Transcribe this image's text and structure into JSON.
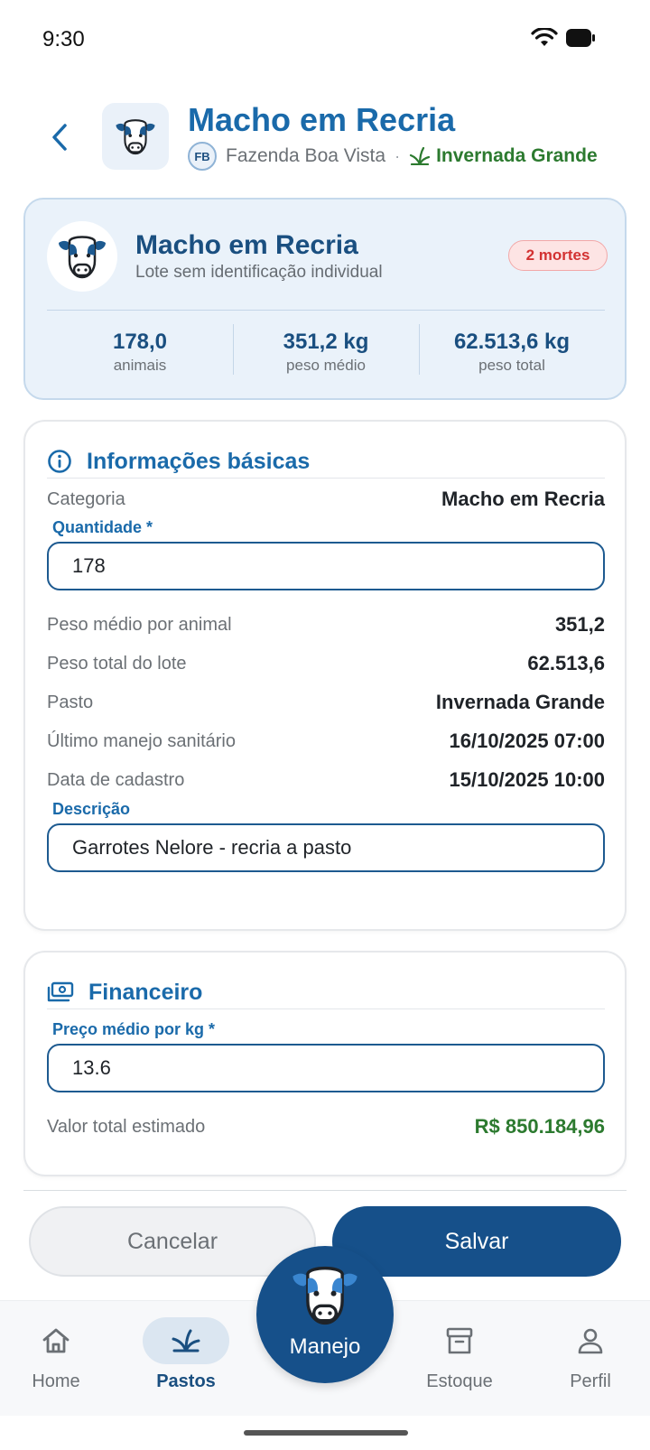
{
  "status": {
    "time": "9:30"
  },
  "header": {
    "title": "Macho em Recria",
    "farm_initials": "FB",
    "farm_name": "Fazenda Boa Vista",
    "separator": "·",
    "pasture_name": "Invernada Grande"
  },
  "summary": {
    "title": "Macho em Recria",
    "subtitle": "Lote sem identificação individual",
    "deaths_badge": "2 mortes",
    "stats": [
      {
        "value": "178,0",
        "label": "animais"
      },
      {
        "value": "351,2 kg",
        "label": "peso médio"
      },
      {
        "value": "62.513,6 kg",
        "label": "peso total"
      }
    ]
  },
  "basic": {
    "title": "Informações básicas",
    "category_label": "Categoria",
    "category_value": "Macho em Recria",
    "quantity_label": "Quantidade *",
    "quantity_value": "178",
    "rows": [
      {
        "label": "Peso médio por animal",
        "value": "351,2"
      },
      {
        "label": "Peso total do lote",
        "value": "62.513,6"
      },
      {
        "label": "Pasto",
        "value": "Invernada Grande"
      },
      {
        "label": "Último manejo sanitário",
        "value": "16/10/2025 07:00"
      },
      {
        "label": "Data de cadastro",
        "value": "15/10/2025 10:00"
      }
    ],
    "description_label": "Descrição",
    "description_value": "Garrotes Nelore - recria a pasto"
  },
  "financial": {
    "title": "Financeiro",
    "price_label": "Preço médio por kg *",
    "price_value": "13.6",
    "total_label": "Valor total estimado",
    "total_value": "R$ 850.184,96"
  },
  "actions": {
    "cancel": "Cancelar",
    "save": "Salvar"
  },
  "nav": {
    "home": "Home",
    "pastos": "Pastos",
    "manejo": "Manejo",
    "estoque": "Estoque",
    "perfil": "Perfil"
  },
  "colors": {
    "primary": "#1a6aaa",
    "primary_dark": "#16508a",
    "success": "#2c7a2f",
    "danger": "#d33232"
  }
}
